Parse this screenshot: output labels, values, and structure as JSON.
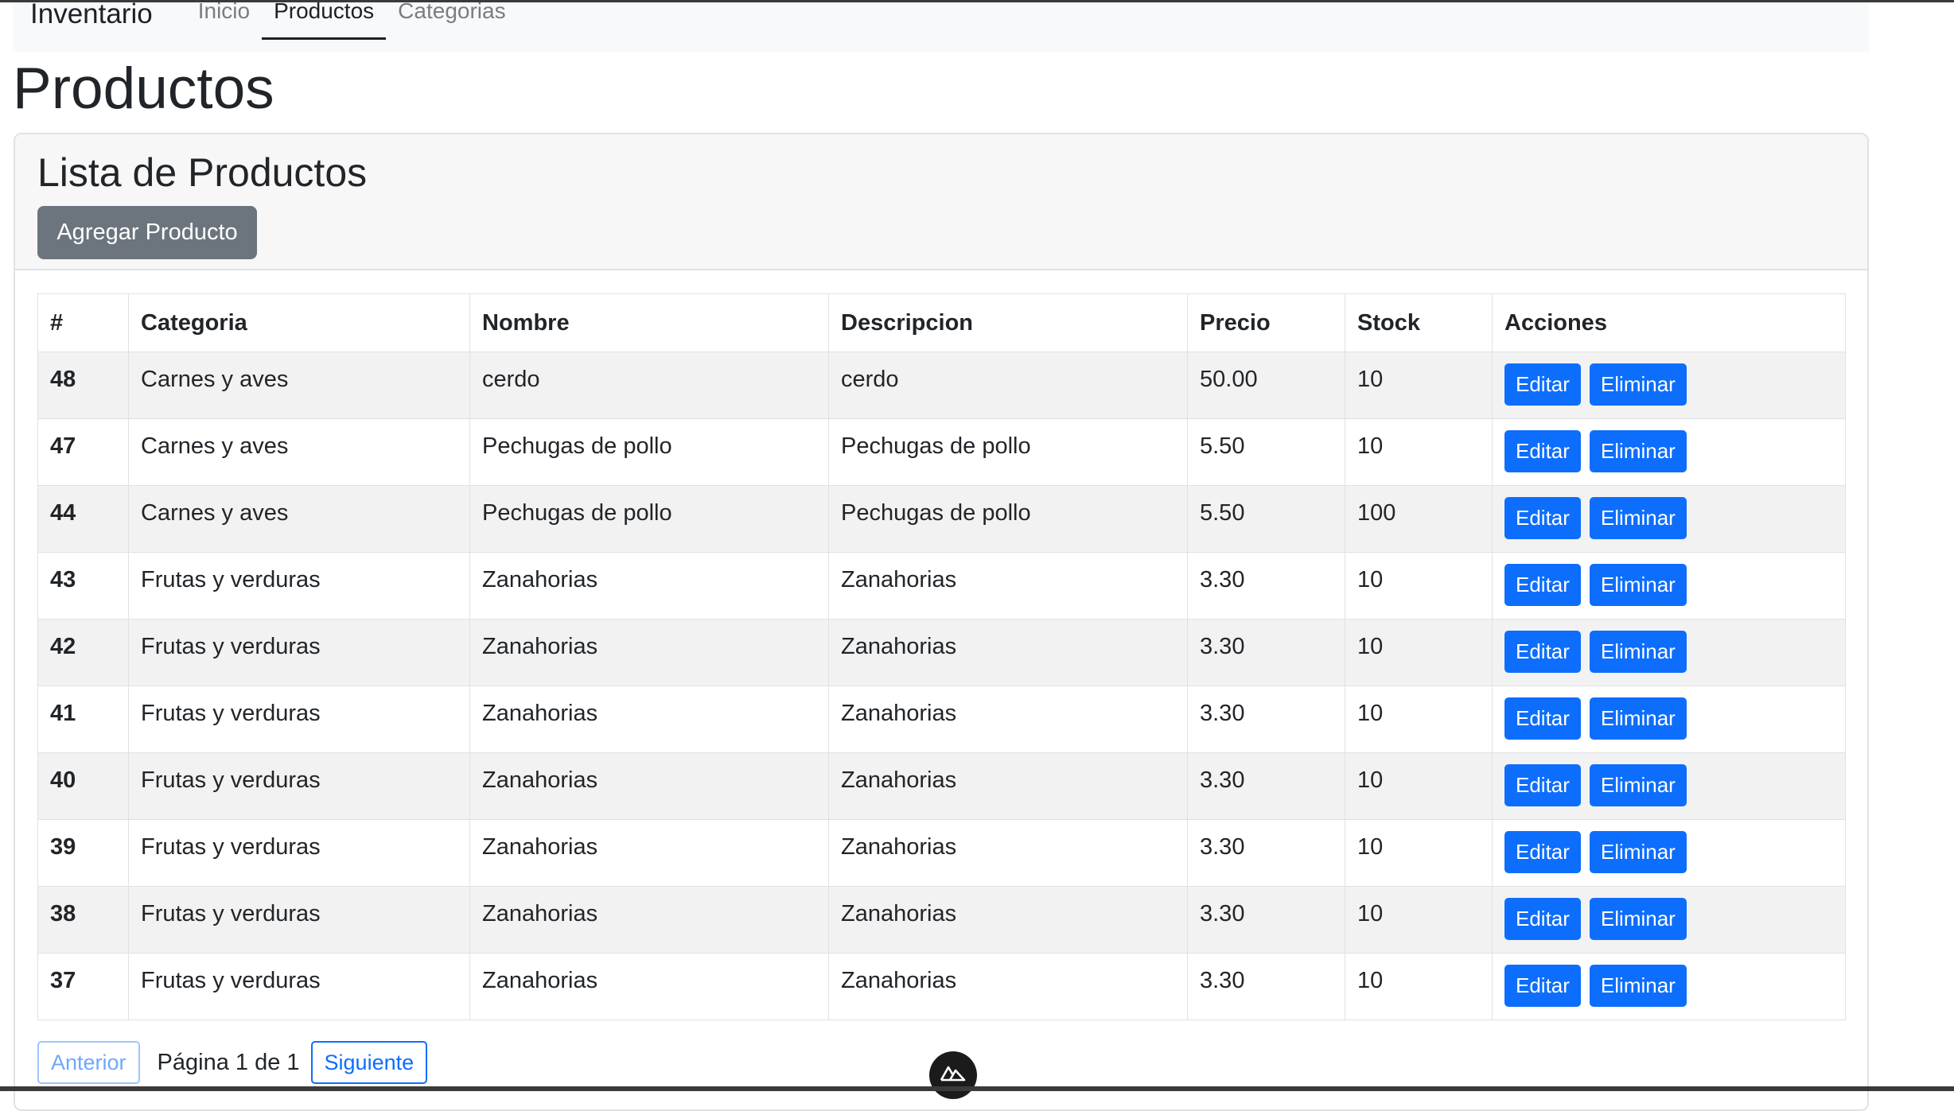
{
  "navbar": {
    "brand": "Inventario",
    "links": [
      {
        "label": "Inicio",
        "active": false
      },
      {
        "label": "Productos",
        "active": true
      },
      {
        "label": "Categorias",
        "active": false
      }
    ]
  },
  "page": {
    "title": "Productos"
  },
  "card": {
    "title": "Lista de Productos",
    "add_button": "Agregar Producto"
  },
  "table": {
    "headers": [
      "#",
      "Categoria",
      "Nombre",
      "Descripcion",
      "Precio",
      "Stock",
      "Acciones"
    ],
    "rows": [
      {
        "id": "48",
        "categoria": "Carnes y aves",
        "nombre": "cerdo",
        "descripcion": "cerdo",
        "precio": "50.00",
        "stock": "10"
      },
      {
        "id": "47",
        "categoria": "Carnes y aves",
        "nombre": "Pechugas de pollo",
        "descripcion": "Pechugas de pollo",
        "precio": "5.50",
        "stock": "10"
      },
      {
        "id": "44",
        "categoria": "Carnes y aves",
        "nombre": "Pechugas de pollo",
        "descripcion": "Pechugas de pollo",
        "precio": "5.50",
        "stock": "100"
      },
      {
        "id": "43",
        "categoria": "Frutas y verduras",
        "nombre": "Zanahorias",
        "descripcion": "Zanahorias",
        "precio": "3.30",
        "stock": "10"
      },
      {
        "id": "42",
        "categoria": "Frutas y verduras",
        "nombre": "Zanahorias",
        "descripcion": "Zanahorias",
        "precio": "3.30",
        "stock": "10"
      },
      {
        "id": "41",
        "categoria": "Frutas y verduras",
        "nombre": "Zanahorias",
        "descripcion": "Zanahorias",
        "precio": "3.30",
        "stock": "10"
      },
      {
        "id": "40",
        "categoria": "Frutas y verduras",
        "nombre": "Zanahorias",
        "descripcion": "Zanahorias",
        "precio": "3.30",
        "stock": "10"
      },
      {
        "id": "39",
        "categoria": "Frutas y verduras",
        "nombre": "Zanahorias",
        "descripcion": "Zanahorias",
        "precio": "3.30",
        "stock": "10"
      },
      {
        "id": "38",
        "categoria": "Frutas y verduras",
        "nombre": "Zanahorias",
        "descripcion": "Zanahorias",
        "precio": "3.30",
        "stock": "10"
      },
      {
        "id": "37",
        "categoria": "Frutas y verduras",
        "nombre": "Zanahorias",
        "descripcion": "Zanahorias",
        "precio": "3.30",
        "stock": "10"
      }
    ],
    "edit_label": "Editar",
    "delete_label": "Eliminar"
  },
  "pagination": {
    "prev_label": "Anterior",
    "page_info": "Página 1 de 1",
    "next_label": "Siguiente"
  },
  "badge": {
    "icon": "nuxt-logo-icon"
  },
  "colors": {
    "primary": "#0d6efd",
    "secondary": "#6c757d",
    "navbar_bg": "#f8f9fa",
    "stripe": "#f2f2f2"
  }
}
